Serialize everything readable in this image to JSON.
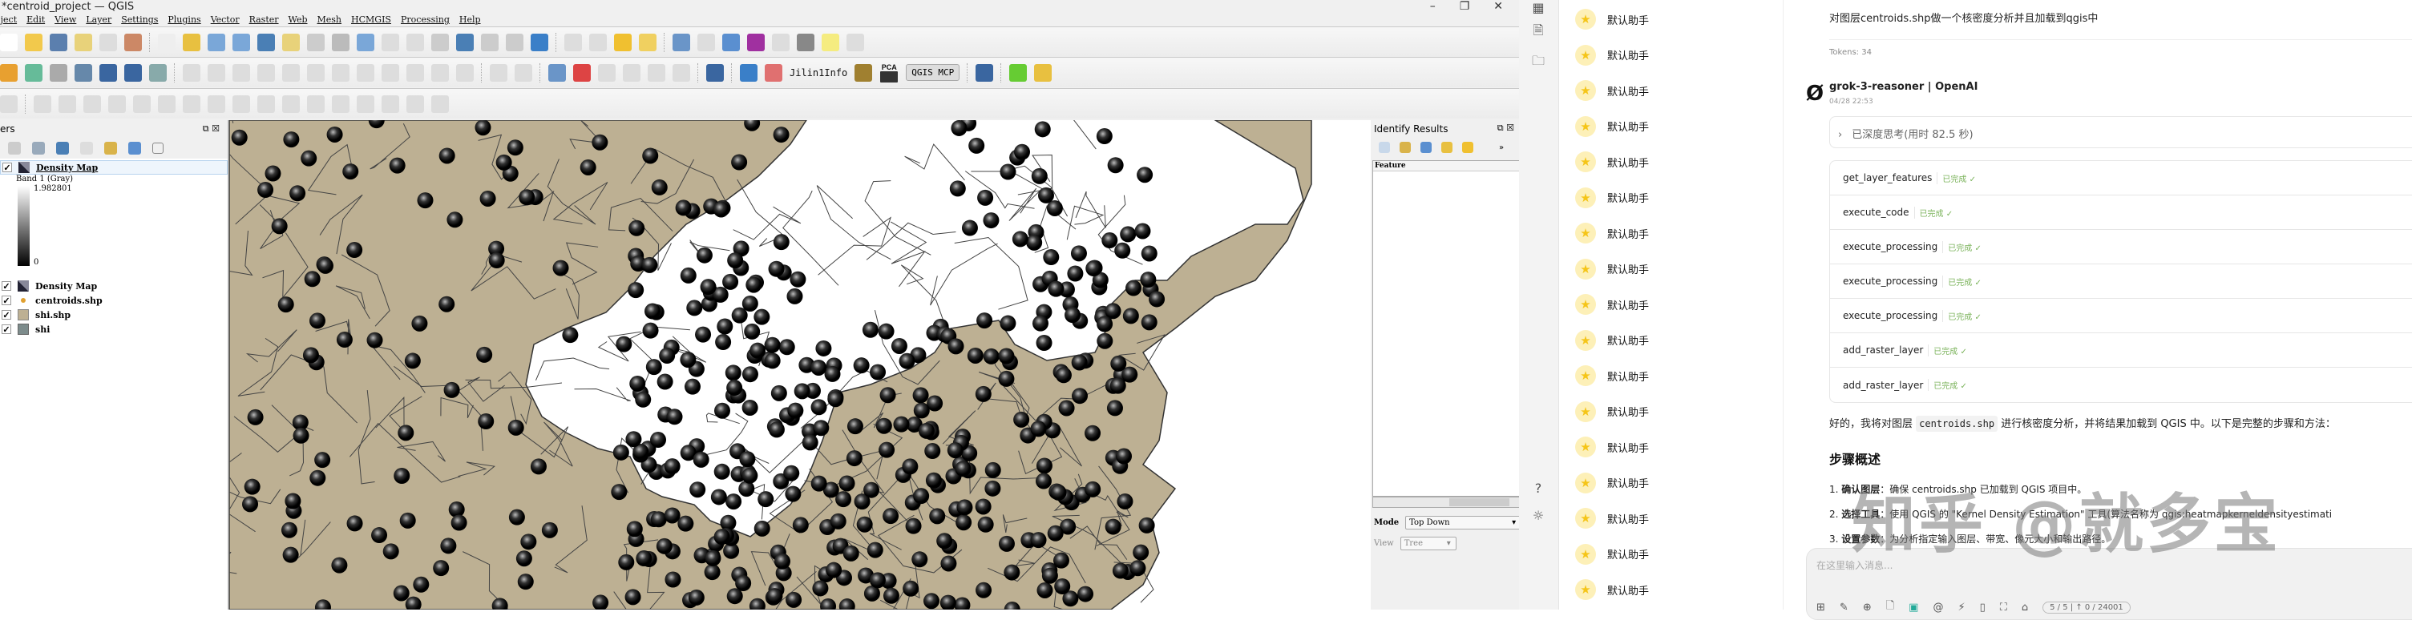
{
  "window": {
    "title": "*centroid_project — QGIS",
    "minimize": "–",
    "maximize": "❐",
    "close": "✕"
  },
  "menu": [
    "oject",
    "Edit",
    "View",
    "Layer",
    "Settings",
    "Plugins",
    "Vector",
    "Raster",
    "Web",
    "Mesh",
    "HCMGIS",
    "Processing",
    "Help"
  ],
  "toolbar": {
    "jilin_label": "Jilin1Info",
    "pca_label": "PCA",
    "mcp_button": "QGIS MCP"
  },
  "layers_panel": {
    "title": "ers",
    "band_label": "Band 1 (Gray)",
    "max_value": "1.982801",
    "min_value": "0",
    "items": [
      {
        "name": "Density Map",
        "checked": true,
        "selected": true
      },
      {
        "name": "Density Map",
        "checked": true
      },
      {
        "name": "centroids.shp",
        "checked": true
      },
      {
        "name": "shi.shp",
        "checked": true
      },
      {
        "name": "shi",
        "checked": true
      }
    ]
  },
  "identify_panel": {
    "title": "Identify Results",
    "column": "Feature",
    "mode_label": "Mode",
    "mode_value": "Top Down",
    "view_label": "View",
    "view_value": "Tree",
    "more": "»"
  },
  "assistants": {
    "label": "默认助手",
    "count": 17
  },
  "chat": {
    "user_message": "对图层centroids.shp做一个核密度分析并且加载到qgis中",
    "tokens": "Tokens: 34",
    "model": "grok-3-reasoner | OpenAI",
    "time": "04/28 22:53",
    "thinking": "已深度思考(用时 82.5 秒)",
    "tools": [
      {
        "name": "get_layer_features",
        "status": "已完成"
      },
      {
        "name": "execute_code",
        "status": "已完成"
      },
      {
        "name": "execute_processing",
        "status": "已完成"
      },
      {
        "name": "execute_processing",
        "status": "已完成"
      },
      {
        "name": "execute_processing",
        "status": "已完成"
      },
      {
        "name": "add_raster_layer",
        "status": "已完成"
      },
      {
        "name": "add_raster_layer",
        "status": "已完成"
      }
    ],
    "response_pre": "好的，我将对图层 ",
    "response_code": "centroids.shp",
    "response_post": " 进行核密度分析，并将结果加载到 QGIS 中。以下是完整的步骤和方法：",
    "heading": "步骤概述",
    "steps": [
      {
        "n": "1.",
        "b": "确认图层",
        "t": "：确保 centroids.shp 已加载到 QGIS 项目中。"
      },
      {
        "n": "2.",
        "b": "选择工具",
        "t": "：使用 QGIS 的 \"Kernel Density Estimation\" 工具(算法名称为 qgis:heatmapkerneldensityestimati"
      },
      {
        "n": "3.",
        "b": "设置参数",
        "t": "：为分析指定输入图层、带宽、像元大小和输出路径。"
      }
    ],
    "input_placeholder": "在这里输入消息...",
    "counter_a": "5 / 5",
    "counter_b": "↑ 0 / 24001"
  },
  "watermark": "知乎 @就多宝",
  "colors": {
    "land": "#bdb093",
    "tool_done": "#7bb35b",
    "star": "#f5c518"
  }
}
